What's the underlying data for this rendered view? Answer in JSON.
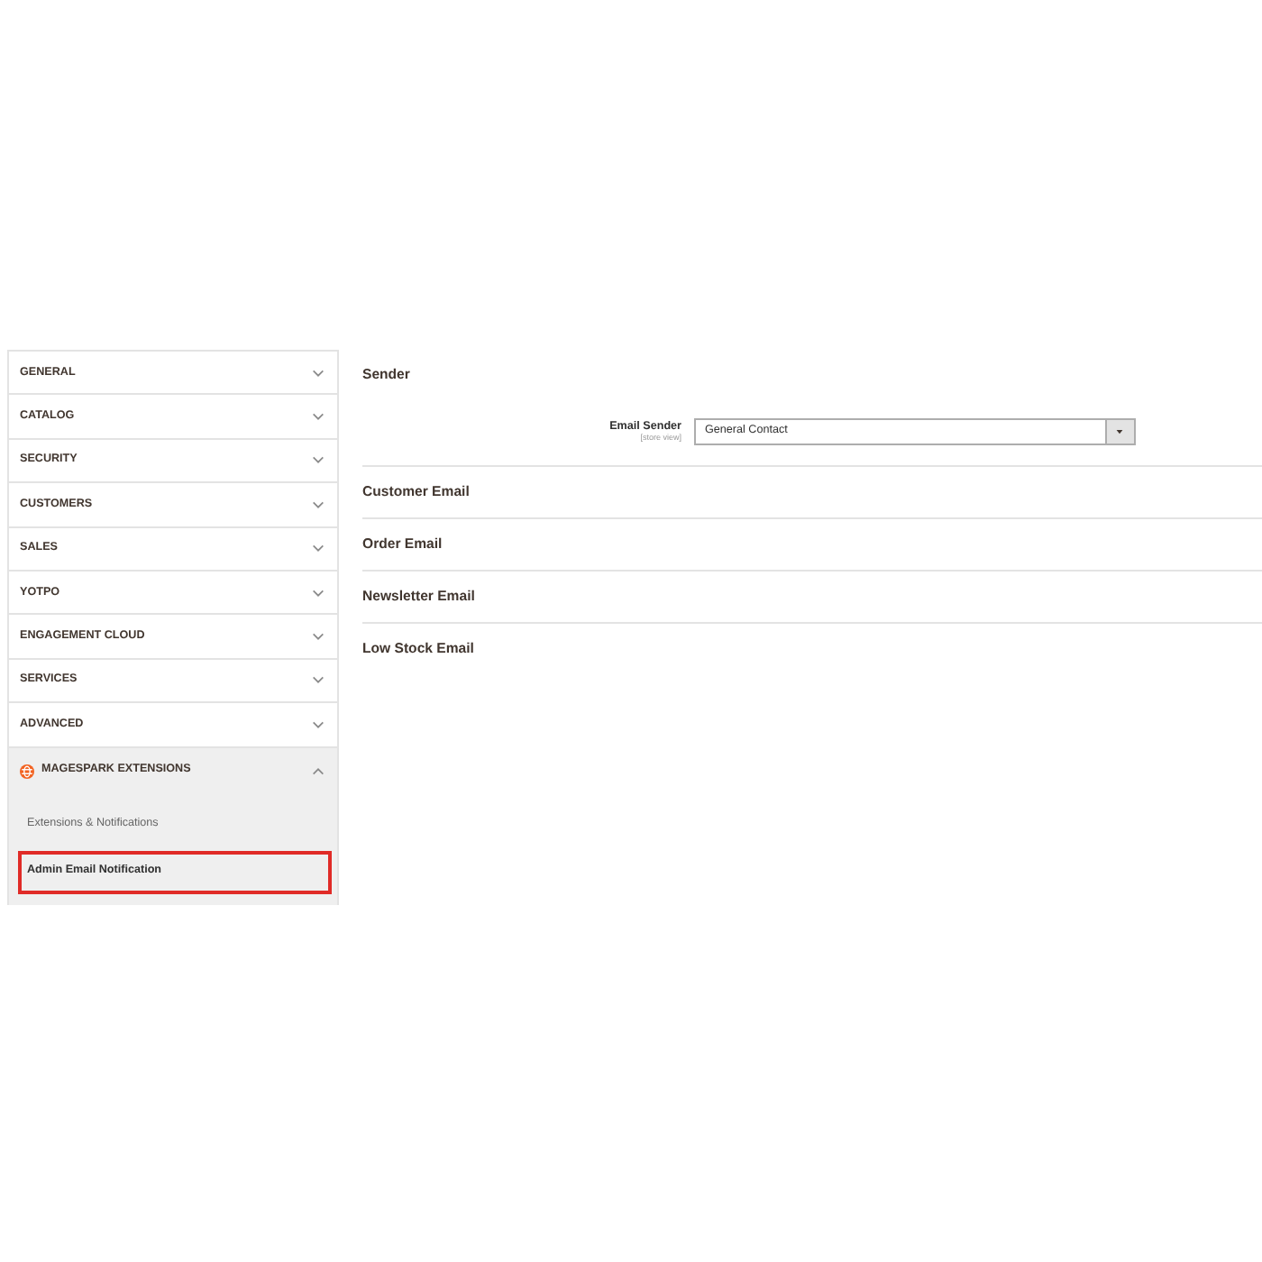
{
  "sidebar": {
    "sections": [
      {
        "label": "GENERAL",
        "kind": "plain",
        "expanded": false
      },
      {
        "label": "CATALOG",
        "kind": "plain",
        "expanded": false
      },
      {
        "label": "SECURITY",
        "kind": "plain",
        "expanded": false
      },
      {
        "label": "CUSTOMERS",
        "kind": "plain",
        "expanded": false
      },
      {
        "label": "SALES",
        "kind": "plain",
        "expanded": false
      },
      {
        "label": "YOTPO",
        "kind": "plain",
        "expanded": false
      },
      {
        "label": "ENGAGEMENT CLOUD",
        "kind": "plain",
        "expanded": false
      },
      {
        "label": "SERVICES",
        "kind": "plain",
        "expanded": false
      },
      {
        "label": "ADVANCED",
        "kind": "plain",
        "expanded": false
      },
      {
        "label": "MAGESPARK EXTENSIONS",
        "kind": "branded",
        "expanded": true,
        "children": [
          {
            "label": "Extensions & Notifications",
            "selected": false
          },
          {
            "label": "Admin Email Notification",
            "selected": true
          }
        ]
      }
    ]
  },
  "groups": [
    {
      "title": "Sender",
      "fields": [
        {
          "label": "Email Sender",
          "scope": "[store view]",
          "value": "General Contact"
        }
      ]
    },
    {
      "title": "Customer Email"
    },
    {
      "title": "Order Email"
    },
    {
      "title": "Newsletter Email"
    },
    {
      "title": "Low Stock Email"
    }
  ]
}
